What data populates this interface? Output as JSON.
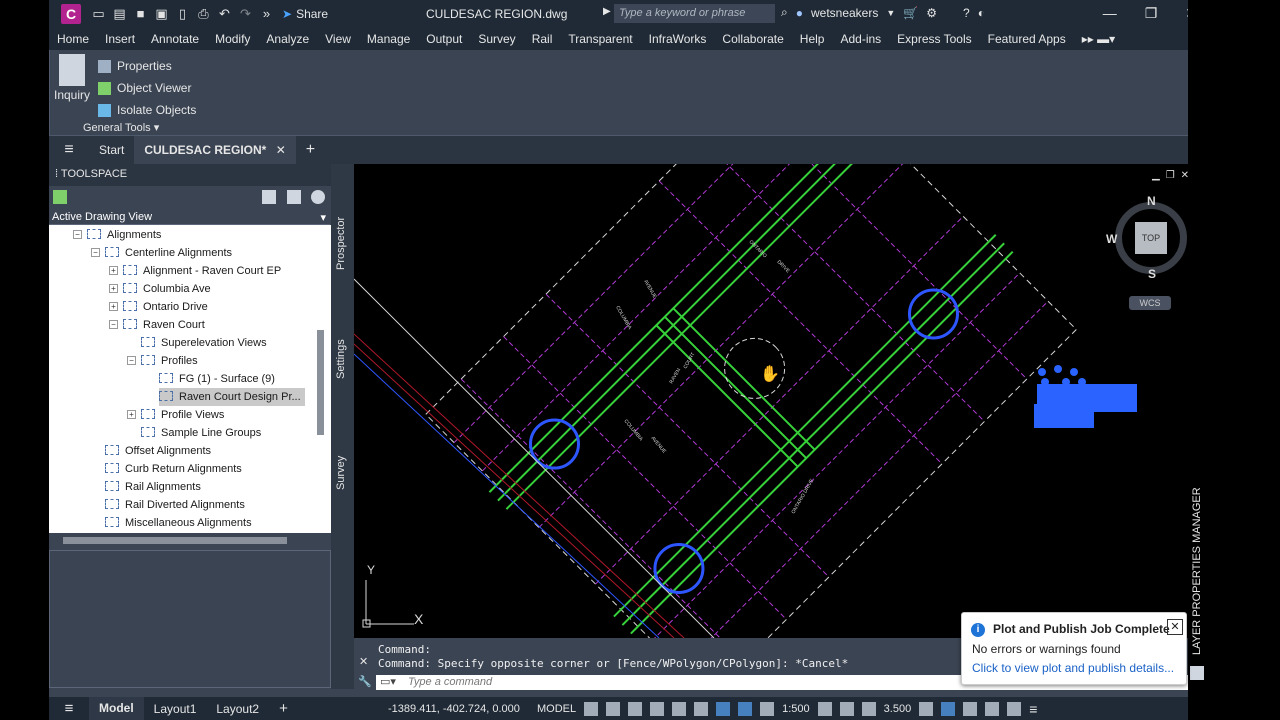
{
  "titlebar": {
    "logo": "C",
    "share": "Share",
    "document": "CULDESAC REGION.dwg",
    "search_placeholder": "Type a keyword or phrase",
    "user": "wetsneakers"
  },
  "menu": [
    "Home",
    "Insert",
    "Annotate",
    "Modify",
    "Analyze",
    "View",
    "Manage",
    "Output",
    "Survey",
    "Rail",
    "Transparent",
    "InfraWorks",
    "Collaborate",
    "Help",
    "Add-ins",
    "Express Tools",
    "Featured Apps"
  ],
  "ribbon": {
    "inquiry": "Inquiry",
    "items": [
      "Properties",
      "Object Viewer",
      "Isolate Objects"
    ],
    "panel": "General Tools"
  },
  "tabs": {
    "start": "Start",
    "active": "CULDESAC REGION*"
  },
  "toolspace": {
    "title": "TOOLSPACE",
    "view": "Active Drawing View",
    "tree": [
      {
        "label": "Alignments"
      },
      {
        "label": "Centerline Alignments"
      },
      {
        "label": "Alignment - Raven Court EP"
      },
      {
        "label": "Columbia Ave"
      },
      {
        "label": "Ontario Drive"
      },
      {
        "label": "Raven Court"
      },
      {
        "label": "Superelevation Views"
      },
      {
        "label": "Profiles"
      },
      {
        "label": "FG (1) - Surface (9)"
      },
      {
        "label": "Raven Court Design Pr..."
      },
      {
        "label": "Profile Views"
      },
      {
        "label": "Sample Line Groups"
      },
      {
        "label": "Offset Alignments"
      },
      {
        "label": "Curb Return Alignments"
      },
      {
        "label": "Rail Alignments"
      },
      {
        "label": "Rail Diverted Alignments"
      },
      {
        "label": "Miscellaneous Alignments"
      }
    ],
    "vtabs": [
      "Prospector",
      "Settings",
      "Survey"
    ]
  },
  "viewcube": {
    "n": "N",
    "s": "S",
    "w": "W",
    "top": "TOP",
    "wcs": "WCS"
  },
  "ucs": {
    "x": "X",
    "y": "Y"
  },
  "map_labels": [
    "ONTARIO",
    "DRIVE",
    "COLUMBIA",
    "AVENUE",
    "RAVEN",
    "COURT",
    "COLUMBIA",
    "AVENUE",
    "ONTARIO DRIVE"
  ],
  "command": {
    "history": [
      "Command:",
      "Command: Specify opposite corner or [Fence/WPolygon/CPolygon]: *Cancel*"
    ],
    "placeholder": "Type a command"
  },
  "status": {
    "model": "Model",
    "layouts": [
      "Layout1",
      "Layout2"
    ],
    "coords": "-1389.411, -402.724, 0.000",
    "mode": "MODEL",
    "scale": "1:500",
    "value": "3.500"
  },
  "toast": {
    "title": "Plot and Publish Job Complete",
    "message": "No errors or warnings found",
    "link": "Click to view plot and publish details..."
  },
  "side_panel": "LAYER PROPERTIES MANAGER",
  "colors": {
    "green": "#37d13a",
    "magenta": "#b23ad6",
    "white_lines": "#d8d8d8",
    "blue": "#2e56ff",
    "toast_link": "#1b62c7"
  }
}
